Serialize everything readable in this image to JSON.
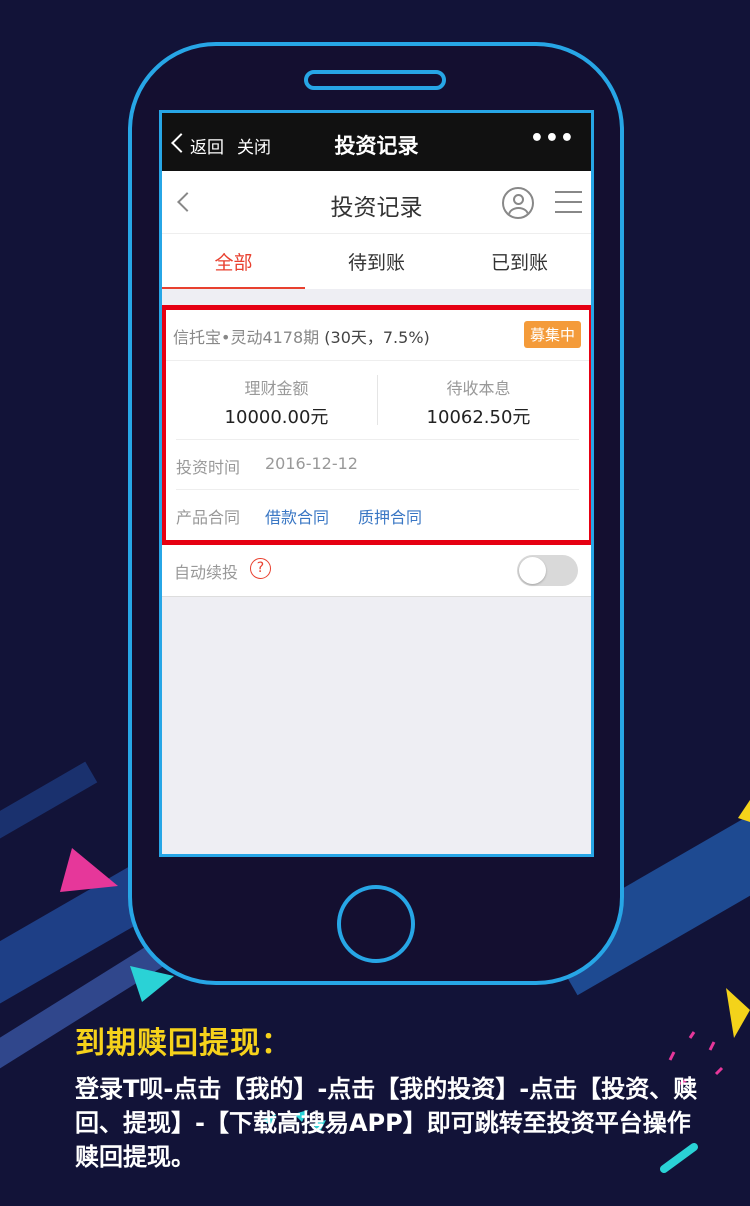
{
  "status_bar": {
    "back_label": "返回",
    "close_label": "关闭",
    "title": "投资记录",
    "more_label": "•••"
  },
  "app_header": {
    "title": "投资记录"
  },
  "tabs": [
    {
      "label": "全部",
      "active": true
    },
    {
      "label": "待到账",
      "active": false
    },
    {
      "label": "已到账",
      "active": false
    }
  ],
  "record": {
    "product_name": "信托宝•灵动4178期",
    "product_terms": "(30天，7.5%)",
    "status_badge": "募集中",
    "amount_label": "理财金额",
    "amount_value": "10000.00元",
    "pending_label": "待收本息",
    "pending_value": "10062.50元",
    "invest_time_label": "投资时间",
    "invest_time_value": "2016-12-12",
    "contract_label": "产品合同",
    "contract_links": [
      "借款合同",
      "质押合同"
    ]
  },
  "auto_reinvest": {
    "label": "自动续投",
    "help_icon": "?",
    "enabled": false
  },
  "caption": {
    "title": "到期赎回提现：",
    "body": "登录T呗-点击【我的】-点击【我的投资】-点击【投资、赎回、提现】-【下载高搜易APP】即可跳转至投资平台操作赎回提现。"
  },
  "colors": {
    "background": "#121338",
    "phone_outline": "#27a6e6",
    "accent_red": "#e8402f",
    "highlight_border": "#e60012",
    "badge_orange": "#f49b3a",
    "link_blue": "#3a77c4",
    "caption_yellow": "#f6d21b"
  }
}
